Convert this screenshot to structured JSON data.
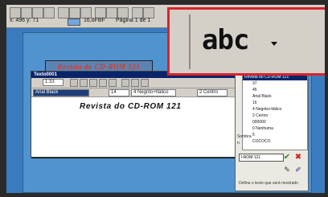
{
  "toolbar": {
    "coords": "x: 496  y: 71",
    "color_hex": "16,8FBF",
    "page_label": "Página 1 de 1"
  },
  "banner": {
    "text": "Revista do CD-ROM 121"
  },
  "doc_window": {
    "title": "Texto0001",
    "zoom": "1:33",
    "font_name": "Arial Black",
    "font_size": "14",
    "style": "4 Negrito+Itálico",
    "align": "2 Centro",
    "body_text": "Revista do CD-ROM 121"
  },
  "props": {
    "items": [
      "Revista do CD-ROM 121",
      "37",
      "45",
      "Arial Black",
      "16",
      "4 Negrito+Itálico",
      "2 Centro",
      "000000",
      "0 Nenhuma",
      "5",
      "COCOCO"
    ],
    "shadow_label": "Sombra",
    "shadow_letter": "n",
    "input_value": "l-ROM 121",
    "hint": "Defina o texto que será mostrado"
  },
  "zoom": {
    "text": "abc"
  },
  "colors": {
    "accent": "#d9232c",
    "desktop": "#3a7bc0",
    "banner_text": "#e8321c"
  }
}
